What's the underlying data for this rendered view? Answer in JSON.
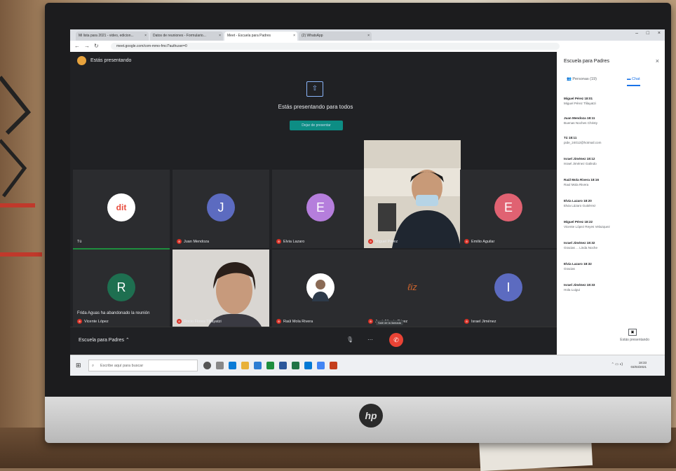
{
  "browser": {
    "tabs": [
      {
        "label": "Mi lista para 2021 - video, edicion..."
      },
      {
        "label": "Datos de reuniones - Formulario..."
      },
      {
        "label": "Meet - Escuela para Padres"
      },
      {
        "label": "(2) WhatsApp"
      }
    ],
    "url": "meet.google.com/com-mmo-fmci?authuser=0"
  },
  "meet": {
    "presenting_label": "Estás presentando",
    "share_message": "Estás presentando para todos",
    "stop_button": "Dejar de presentar",
    "tiles_row1": [
      {
        "name": "Tú",
        "avatar": "dit",
        "color": "#2b2c2f"
      },
      {
        "name": "Juan Mendoza",
        "avatar": "J",
        "color": "#5c6bc0"
      },
      {
        "name": "Elvia Lazaro",
        "avatar": "E",
        "color": "#b57edc"
      },
      {
        "name": "Miguel Pérez",
        "avatar": "",
        "color": "#444"
      },
      {
        "name": "Emilio Aguilar",
        "avatar": "E",
        "color": "#e06272"
      }
    ],
    "tiles_row2": [
      {
        "name": "Vicente López",
        "avatar": "R",
        "color": "#1e6f50"
      },
      {
        "name": "Rocio Flores Tlilayatzi",
        "avatar": "",
        "color": "#444"
      },
      {
        "name": "Raúl Mola Rivera",
        "avatar": "",
        "color": "#2b2c2f"
      },
      {
        "name": "José Alberto Pérez",
        "avatar": "",
        "color": "#2b2c2f"
      },
      {
        "name": "Israel Jiménez",
        "avatar": "I",
        "color": "#5c6bc0"
      }
    ],
    "leave_note": "Frida Aguas ha abandonado la reunión",
    "meeting_name": "Escuela para Padres",
    "hangup_tooltip": "Salir de la llamada"
  },
  "panel": {
    "title": "Escuela para Padres",
    "tab_people": "Personas (19)",
    "tab_chat": "Chat",
    "messages": [
      {
        "who": "Miguel Pérez  18:01",
        "text": "Miguel Pérez Tlilayatzi"
      },
      {
        "who": "Juan Mendoza  18:11",
        "text": "Buenas Noches Christy"
      },
      {
        "who": "Tú  18:11",
        "text": "pide_24012@hotmail.com"
      },
      {
        "who": "Israel Jiménez  18:12",
        "text": "Israel Jiménez Galindo"
      },
      {
        "who": "Raúl Mola Rivera  18:16",
        "text": "Raul Mola Rivera"
      },
      {
        "who": "Elvia Lazaro  18:20",
        "text": "Elvia Lázaro Gutiérrez"
      },
      {
        "who": "Miguel Pérez  18:22",
        "text": "Vicente López Reyes Velazquez"
      },
      {
        "who": "Israel Jiménez  18:32",
        "text": "Gracias ... Linda Noche"
      },
      {
        "who": "Elvia Lazaro  18:32",
        "text": "Gracias"
      },
      {
        "who": "Israel Jiménez  18:33",
        "text": "Hola Luigui"
      }
    ],
    "present_now": "Estás presentando"
  },
  "taskbar": {
    "search_placeholder": "Escribe aquí para buscar",
    "time": "18:33",
    "date": "03/03/2021"
  }
}
